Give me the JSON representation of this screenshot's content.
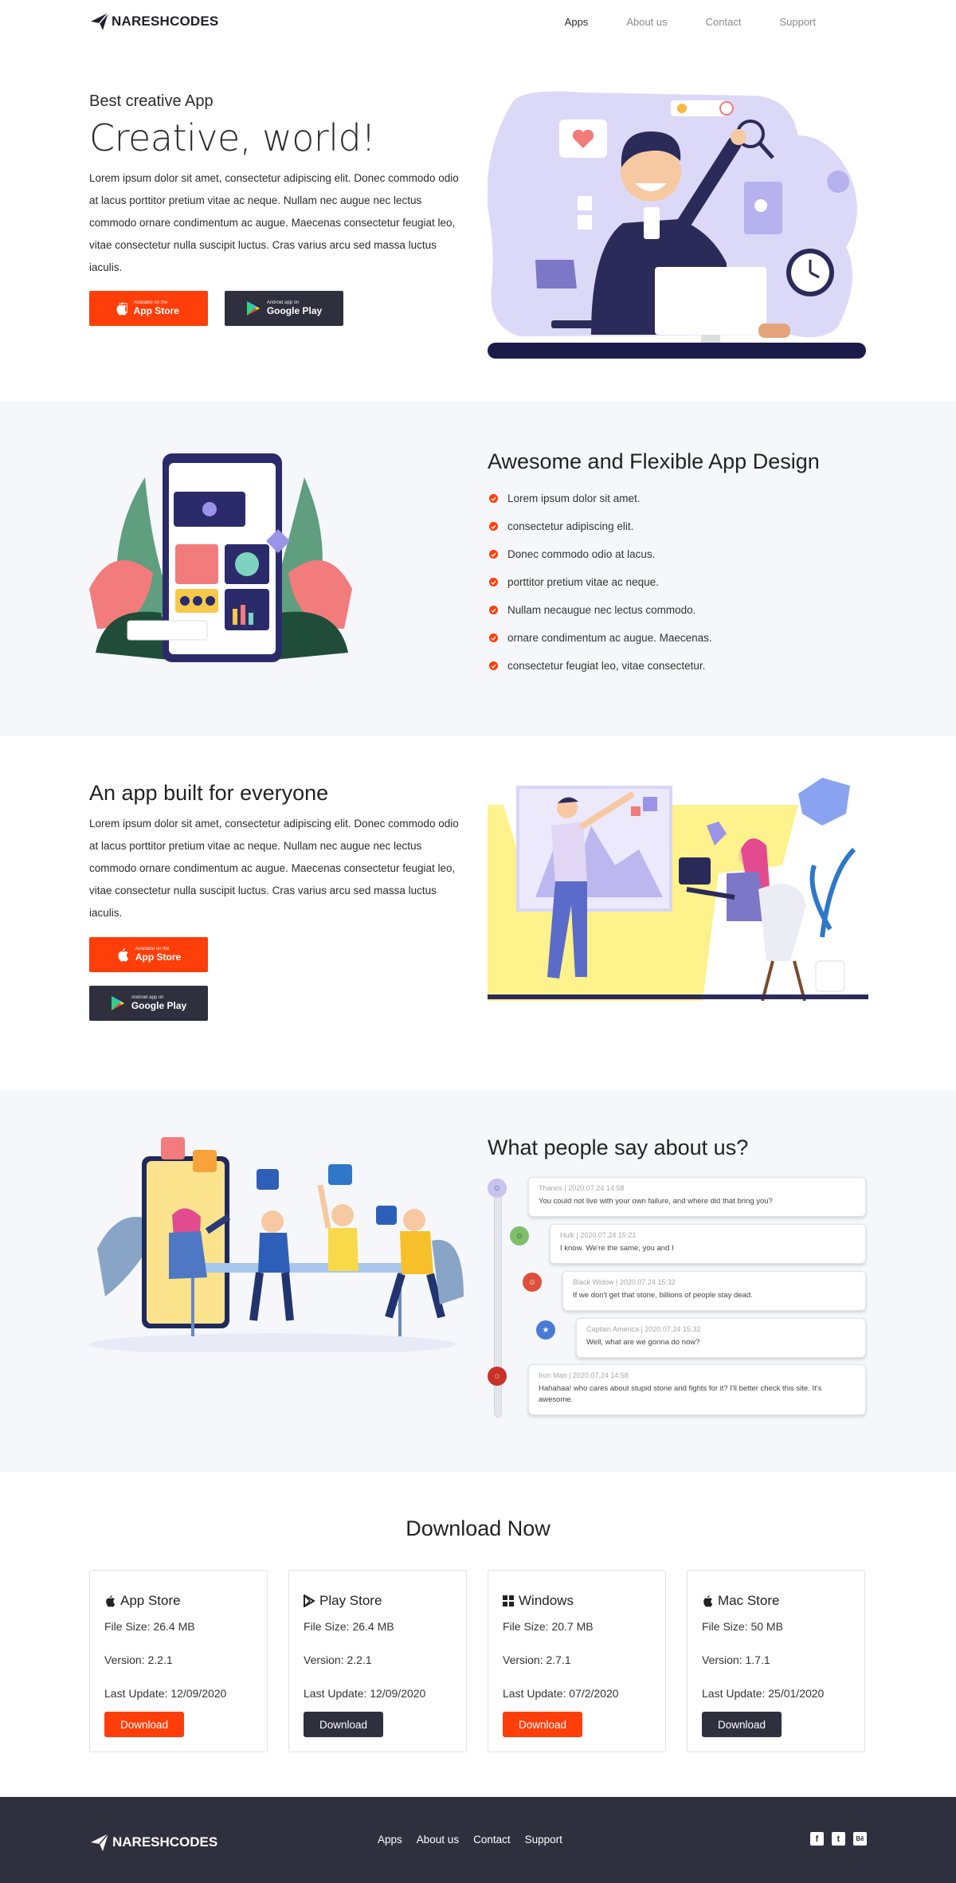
{
  "brand": {
    "name": "NARESHCODES"
  },
  "nav": {
    "items": [
      "Apps",
      "About us",
      "Contact",
      "Support"
    ]
  },
  "hero": {
    "eyebrow": "Best creative App",
    "title": "Creative, world!",
    "text": "Lorem ipsum dolor sit amet, consectetur adipiscing elit. Donec commodo odio at lacus porttitor pretium vitae ac neque. Nullam nec augue nec lectus commodo ornare condimentum ac augue. Maecenas consectetur feugiat leo, vitae consectetur nulla suscipit luctus. Cras varius arcu sed massa luctus iaculis."
  },
  "store_buttons": {
    "apple_small": "Available on the",
    "apple_big": "App Store",
    "google_small": "Android app on",
    "google_big": "Google Play"
  },
  "features": {
    "title": "Awesome and Flexible App Design",
    "items": [
      "Lorem ipsum dolor sit amet.",
      "consectetur adipiscing elit.",
      "Donec commodo odio at lacus.",
      "porttitor pretium vitae ac neque.",
      "Nullam necaugue nec lectus commodo.",
      "ornare condimentum ac augue. Maecenas.",
      "consectetur feugiat leo, vitae consectetur."
    ]
  },
  "everyone": {
    "title": "An app built for everyone",
    "text": "Lorem ipsum dolor sit amet, consectetur adipiscing elit. Donec commodo odio at lacus porttitor pretium vitae ac neque. Nullam nec augue nec lectus commodo ornare condimentum ac augue. Maecenas consectetur feugiat leo, vitae consectetur nulla suscipit luctus. Cras varius arcu sed massa luctus iaculis."
  },
  "testimonials": {
    "title": "What people say about us?",
    "items": [
      {
        "meta": "Thanos | 2020.07.24 14:58",
        "text": "You could not live with your own failure, and where did that bring you?"
      },
      {
        "meta": "Hulk | 2020.07.24 15:21",
        "text": "I know. We're the same, you and I"
      },
      {
        "meta": "Black Widow | 2020.07.24 15:32",
        "text": "If we don't get that stone, billions of people stay dead."
      },
      {
        "meta": "Captain America | 2020.07.24 15:32",
        "text": "Well, what are we gonna do now?"
      },
      {
        "meta": "Iron Man | 2020.07.24 14:58",
        "text": "Hahahaa! who cares about stupid stone and fights for it? I'll better check this site. It's awesome."
      }
    ]
  },
  "download": {
    "title": "Download Now",
    "cards": [
      {
        "name": "App Store",
        "size": "File Size: 26.4 MB",
        "version": "Version: 2.2.1",
        "update": "Last Update: 12/09/2020",
        "button": "Download",
        "icon": "apple-icon"
      },
      {
        "name": "Play Store",
        "size": "File Size: 26.4 MB",
        "version": "Version: 2.2.1",
        "update": "Last Update: 12/09/2020",
        "button": "Download",
        "icon": "play-icon"
      },
      {
        "name": "Windows",
        "size": "File Size: 20.7 MB",
        "version": "Version: 2.7.1",
        "update": "Last Update: 07/2/2020",
        "button": "Download",
        "icon": "windows-icon"
      },
      {
        "name": "Mac Store",
        "size": "File Size: 50 MB",
        "version": "Version: 1.7.1",
        "update": "Last Update: 25/01/2020",
        "button": "Download",
        "icon": "apple-icon"
      }
    ]
  },
  "footer": {
    "nav": [
      "Apps",
      "About us",
      "Contact",
      "Support"
    ],
    "social": [
      "facebook-icon",
      "twitter-icon",
      "behance-icon"
    ],
    "social_glyphs": [
      "f",
      "t",
      "Bē"
    ]
  },
  "colors": {
    "accent": "#ff3e0a",
    "dark": "#2f2f3e",
    "section_bg": "#f5f7fa"
  }
}
